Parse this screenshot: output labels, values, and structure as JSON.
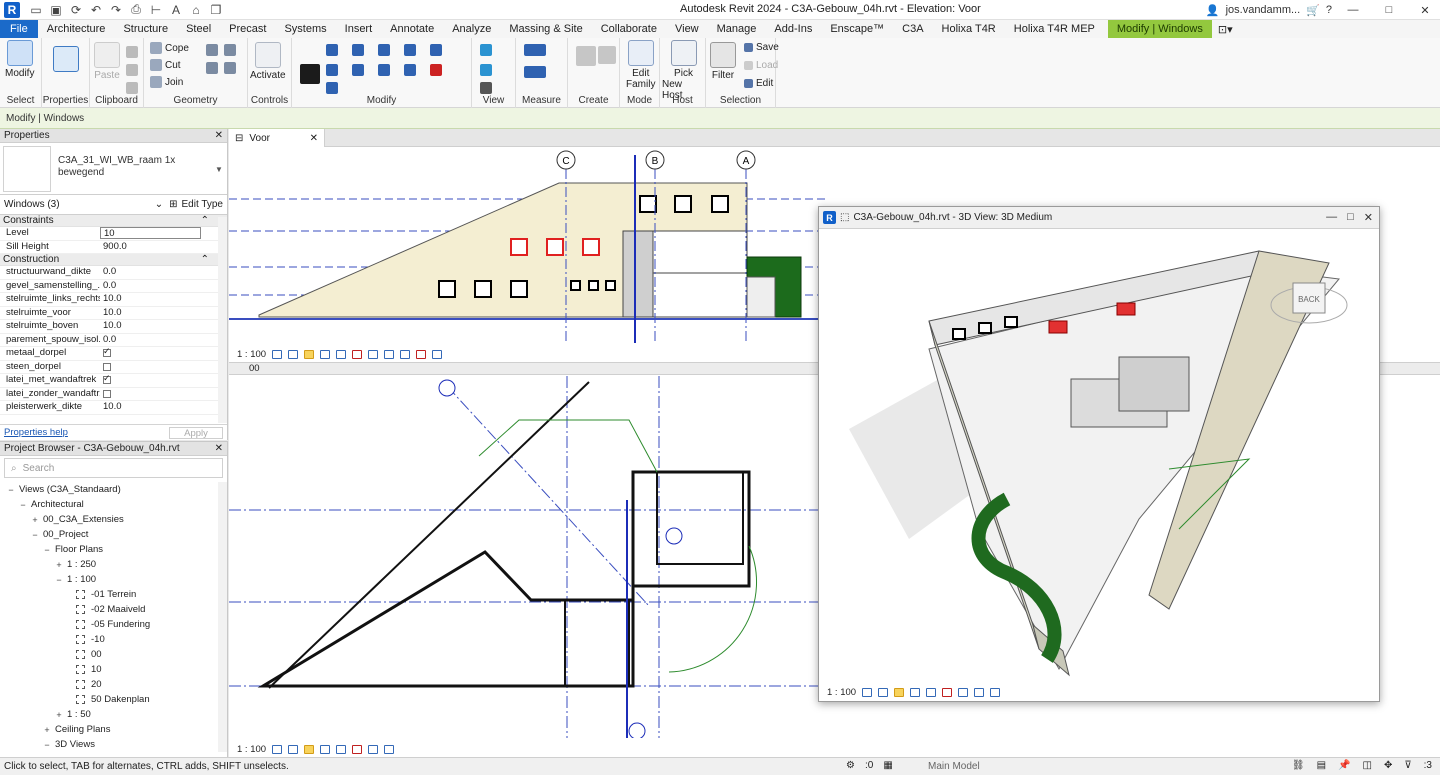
{
  "app": {
    "title": "Autodesk Revit 2024 - C3A-Gebouw_04h.rvt - Elevation: Voor",
    "user": "jos.vandamm...",
    "logo": "R"
  },
  "tabs": [
    "File",
    "Architecture",
    "Structure",
    "Steel",
    "Precast",
    "Systems",
    "Insert",
    "Annotate",
    "Analyze",
    "Massing & Site",
    "Collaborate",
    "View",
    "Manage",
    "Add-Ins",
    "Enscape™",
    "C3A",
    "Holixa T4R",
    "Holixa T4R MEP",
    "Modify | Windows"
  ],
  "ribbon": {
    "select": {
      "modify": "Modify",
      "label": "Select"
    },
    "properties": {
      "label": "Properties"
    },
    "clipboard": {
      "paste": "Paste",
      "label": "Clipboard"
    },
    "geometry": {
      "cope": "Cope",
      "cut": "Cut",
      "join": "Join",
      "label": "Geometry"
    },
    "controls": {
      "activate": "Activate",
      "label": "Controls"
    },
    "modify": {
      "label": "Modify"
    },
    "view": {
      "label": "View"
    },
    "measure": {
      "label": "Measure"
    },
    "create": {
      "label": "Create"
    },
    "mode": {
      "edit_family_1": "Edit",
      "edit_family_2": "Family",
      "label": "Mode"
    },
    "host": {
      "pick_1": "Pick",
      "pick_2": "New Host",
      "label": "Host"
    },
    "selection": {
      "filter": "Filter",
      "save": "Save",
      "load": "Load",
      "edit": "Edit",
      "label": "Selection"
    }
  },
  "context_bar": "Modify | Windows",
  "properties": {
    "header": "Properties",
    "type_name_1": "C3A_31_WI_WB_raam 1x",
    "type_name_2": "bewegend",
    "instance": "Windows (3)",
    "edit_type": "Edit Type",
    "groups": [
      {
        "name": "Constraints",
        "rows": [
          {
            "name": "Level",
            "value": "10",
            "kind": "edit"
          },
          {
            "name": "Sill Height",
            "value": "900.0",
            "kind": "text"
          }
        ]
      },
      {
        "name": "Construction",
        "rows": [
          {
            "name": "structuurwand_dikte",
            "value": "0.0",
            "kind": "text"
          },
          {
            "name": "gevel_samenstelling_...",
            "value": "0.0",
            "kind": "text"
          },
          {
            "name": "stelruimte_links_rechts",
            "value": "10.0",
            "kind": "text"
          },
          {
            "name": "stelruimte_voor",
            "value": "10.0",
            "kind": "text"
          },
          {
            "name": "stelruimte_boven",
            "value": "10.0",
            "kind": "text"
          },
          {
            "name": "parement_spouw_isol...",
            "value": "0.0",
            "kind": "text"
          },
          {
            "name": "metaal_dorpel",
            "value": true,
            "kind": "check"
          },
          {
            "name": "steen_dorpel",
            "value": false,
            "kind": "check"
          },
          {
            "name": "latei_met_wandaftrek",
            "value": true,
            "kind": "check"
          },
          {
            "name": "latei_zonder_wandaftr...",
            "value": false,
            "kind": "check"
          },
          {
            "name": "pleisterwerk_dikte",
            "value": "10.0",
            "kind": "text"
          }
        ]
      }
    ],
    "help": "Properties help",
    "apply": "Apply"
  },
  "browser": {
    "header": "Project Browser - C3A-Gebouw_04h.rvt",
    "search_placeholder": "Search",
    "items": [
      {
        "label": "Views (C3A_Standaard)",
        "indent": 0,
        "toggle": "−"
      },
      {
        "label": "Architectural",
        "indent": 1,
        "toggle": "−"
      },
      {
        "label": "00_C3A_Extensies",
        "indent": 2,
        "toggle": "+"
      },
      {
        "label": "00_Project",
        "indent": 2,
        "toggle": "−"
      },
      {
        "label": "Floor Plans",
        "indent": 3,
        "toggle": "−"
      },
      {
        "label": "1 : 250",
        "indent": 4,
        "toggle": "+"
      },
      {
        "label": "1 : 100",
        "indent": 4,
        "toggle": "−"
      },
      {
        "label": "-01 Terrein",
        "indent": 5,
        "toggle": "",
        "view": true
      },
      {
        "label": "-02 Maaiveld",
        "indent": 5,
        "toggle": "",
        "view": true
      },
      {
        "label": "-05 Fundering",
        "indent": 5,
        "toggle": "",
        "view": true
      },
      {
        "label": "-10",
        "indent": 5,
        "toggle": "",
        "view": true
      },
      {
        "label": "00",
        "indent": 5,
        "toggle": "",
        "view": true
      },
      {
        "label": "10",
        "indent": 5,
        "toggle": "",
        "view": true
      },
      {
        "label": "20",
        "indent": 5,
        "toggle": "",
        "view": true
      },
      {
        "label": "50 Dakenplan",
        "indent": 5,
        "toggle": "",
        "view": true
      },
      {
        "label": "1 : 50",
        "indent": 4,
        "toggle": "+"
      },
      {
        "label": "Ceiling Plans",
        "indent": 3,
        "toggle": "+"
      },
      {
        "label": "3D Views",
        "indent": 3,
        "toggle": "−"
      }
    ]
  },
  "views": {
    "tab_voor": "Voor",
    "scale": "1 : 100",
    "plan_header": "00",
    "grids": [
      "C",
      "B",
      "A"
    ]
  },
  "window3d": {
    "title": "C3A-Gebouw_04h.rvt - 3D View: 3D Medium",
    "scale": "1 : 100",
    "viewcube": "BACK"
  },
  "status": {
    "message": "Click to select, TAB for alternates, CTRL adds, SHIFT unselects.",
    "model": "Main Model",
    "filter_count": ":3",
    "worksets": ":0"
  }
}
